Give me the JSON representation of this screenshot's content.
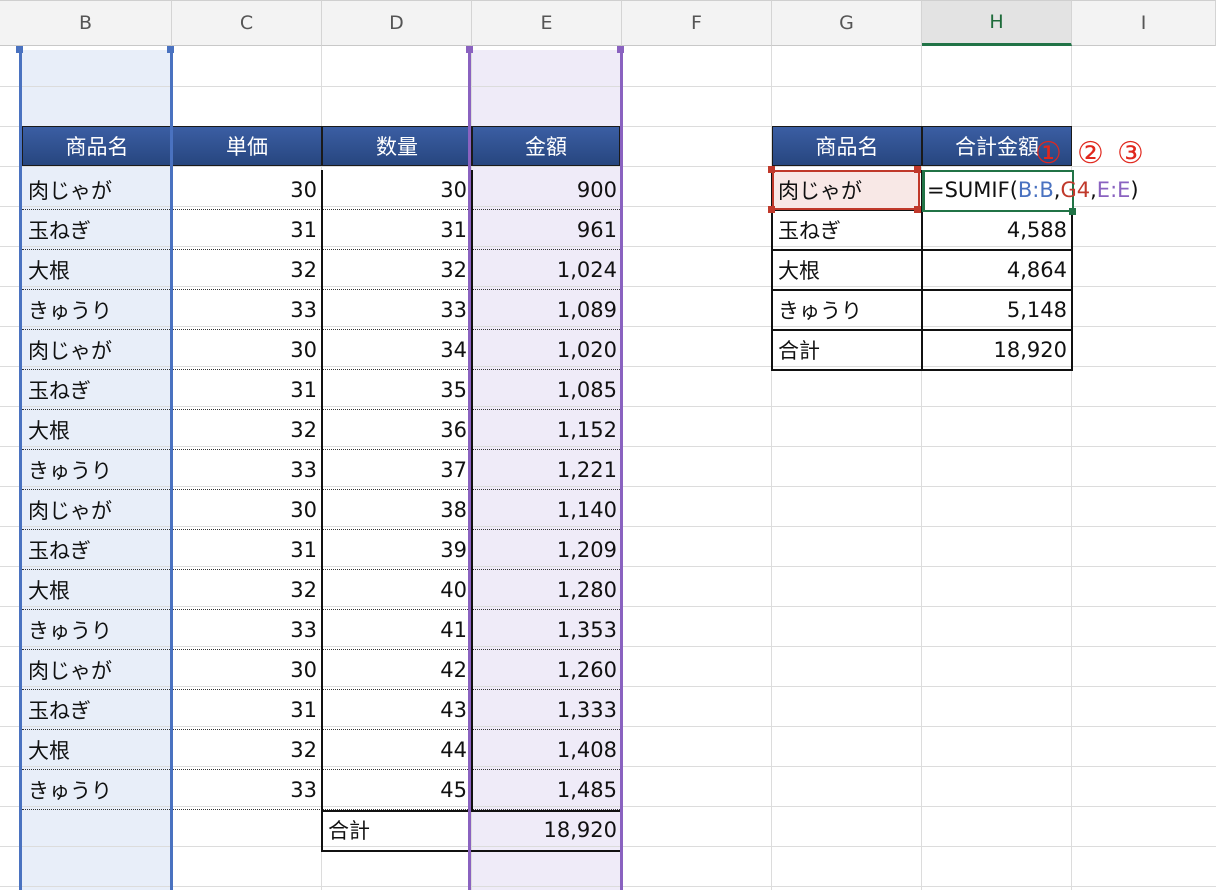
{
  "columns": [
    "B",
    "C",
    "D",
    "E",
    "F",
    "G",
    "H",
    "I"
  ],
  "active_column": "H",
  "table1": {
    "headers": [
      "商品名",
      "単価",
      "数量",
      "金額"
    ],
    "rows": [
      [
        "肉じゃが",
        "30",
        "30",
        "900"
      ],
      [
        "玉ねぎ",
        "31",
        "31",
        "961"
      ],
      [
        "大根",
        "32",
        "32",
        "1,024"
      ],
      [
        "きゅうり",
        "33",
        "33",
        "1,089"
      ],
      [
        "肉じゃが",
        "30",
        "34",
        "1,020"
      ],
      [
        "玉ねぎ",
        "31",
        "35",
        "1,085"
      ],
      [
        "大根",
        "32",
        "36",
        "1,152"
      ],
      [
        "きゅうり",
        "33",
        "37",
        "1,221"
      ],
      [
        "肉じゃが",
        "30",
        "38",
        "1,140"
      ],
      [
        "玉ねぎ",
        "31",
        "39",
        "1,209"
      ],
      [
        "大根",
        "32",
        "40",
        "1,280"
      ],
      [
        "きゅうり",
        "33",
        "41",
        "1,353"
      ],
      [
        "肉じゃが",
        "30",
        "42",
        "1,260"
      ],
      [
        "玉ねぎ",
        "31",
        "43",
        "1,333"
      ],
      [
        "大根",
        "32",
        "44",
        "1,408"
      ],
      [
        "きゅうり",
        "33",
        "45",
        "1,485"
      ]
    ],
    "total_label": "合計",
    "total_value": "18,920"
  },
  "table2": {
    "headers": [
      "商品名",
      "合計金額"
    ],
    "rows": [
      [
        "肉じゃが",
        ""
      ],
      [
        "玉ねぎ",
        "4,588"
      ],
      [
        "大根",
        "4,864"
      ],
      [
        "きゅうり",
        "5,148"
      ],
      [
        "合計",
        "18,920"
      ]
    ]
  },
  "formula": {
    "prefix": "=SUMIF(",
    "arg1": "B:B",
    "sep1": ",",
    "arg2": "G4",
    "sep2": ",",
    "arg3": "E:E",
    "suffix": ")"
  },
  "markers": [
    "①",
    "②",
    "③"
  ],
  "colors": {
    "header_fill": "#2f4f8c",
    "range1": "#4a72c0",
    "range2": "#c0392b",
    "range3": "#8a62c0",
    "active_green": "#217346",
    "marker_red": "#e0281e"
  }
}
